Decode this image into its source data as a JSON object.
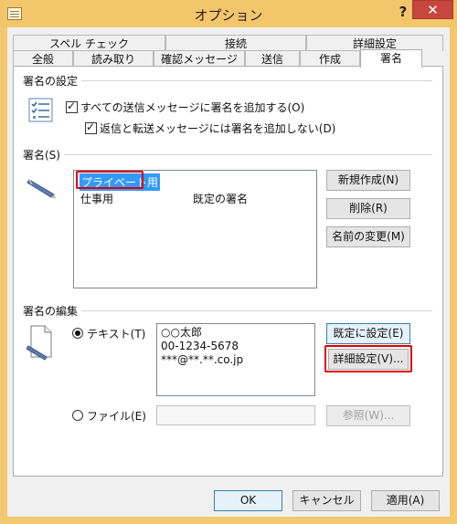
{
  "window": {
    "title": "オプション",
    "help": "?",
    "close": "✕"
  },
  "tabs_back": [
    {
      "label": "スペル チェック"
    },
    {
      "label": "接続"
    },
    {
      "label": "詳細設定"
    }
  ],
  "tabs_front": [
    {
      "label": "全般"
    },
    {
      "label": "読み取り"
    },
    {
      "label": "確認メッセージ"
    },
    {
      "label": "送信"
    },
    {
      "label": "作成"
    },
    {
      "label": "署名",
      "active": true
    }
  ],
  "signature_settings": {
    "heading": "署名の設定",
    "add_to_all": "すべての送信メッセージに署名を追加する(O)",
    "add_to_all_checked": true,
    "no_reply_forward": "返信と転送メッセージには署名を追加しない(D)",
    "no_reply_forward_checked": true
  },
  "signatures": {
    "heading": "署名(S)",
    "items": [
      {
        "name": "プライベート用",
        "default": "",
        "selected": true
      },
      {
        "name": "仕事用",
        "default": "既定の署名",
        "selected": false
      }
    ],
    "new_button": "新規作成(N)",
    "delete_button": "削除(R)",
    "rename_button": "名前の変更(M)"
  },
  "edit_signature": {
    "heading": "署名の編集",
    "text_option": "テキスト(T)",
    "text_selected": true,
    "text_lines": [
      "○○太郎",
      "00-1234-5678",
      "***@**.**.co.jp"
    ],
    "set_default_button": "既定に設定(E)",
    "advanced_button": "詳細設定(V)...",
    "file_option": "ファイル(E)",
    "file_value": "",
    "browse_button": "参照(W)..."
  },
  "footer": {
    "ok": "OK",
    "cancel": "キャンセル",
    "apply": "適用(A)"
  },
  "colors": {
    "title_bar": "#f4c66c",
    "close": "#c7463e",
    "selection": "#3399ff",
    "highlight_frame": "#e00000"
  }
}
